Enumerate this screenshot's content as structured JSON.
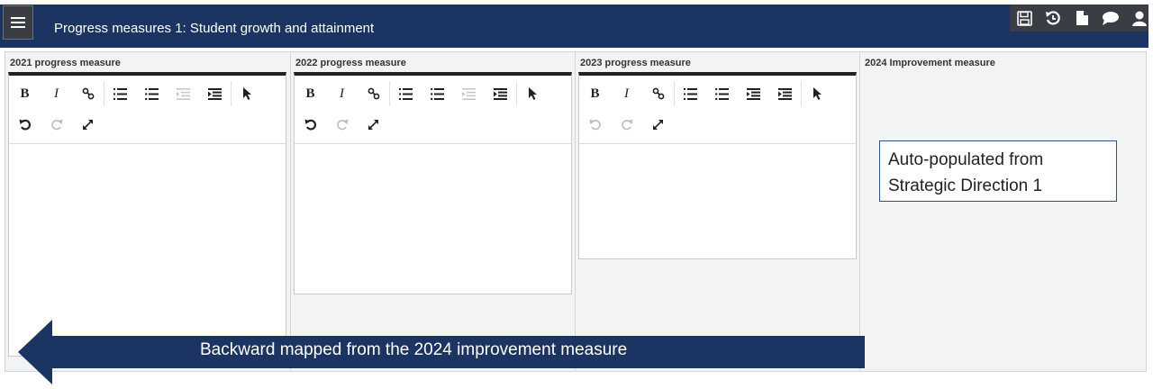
{
  "header": {
    "title": "Progress measures 1: Student growth and attainment",
    "menu_icon": "hamburger-icon",
    "tool_icons": [
      "save-icon",
      "history-icon",
      "document-icon",
      "comment-icon",
      "user-icon"
    ]
  },
  "columns": [
    {
      "label": "2021 progress measure"
    },
    {
      "label": "2022 progress measure"
    },
    {
      "label": "2023 progress measure"
    },
    {
      "label": "2024 Improvement measure"
    }
  ],
  "toolbar": {
    "bold": "B",
    "italic": "I",
    "icons": [
      "bold-icon",
      "italic-icon",
      "link-icon",
      "numbered-list-icon",
      "bullet-list-icon",
      "outdent-icon",
      "indent-icon",
      "pointer-icon",
      "undo-icon",
      "redo-icon",
      "expand-icon"
    ]
  },
  "callout": {
    "line1": "Auto-populated from",
    "line2": "Strategic Direction 1"
  },
  "arrow": {
    "label": "Backward mapped from the 2024 improvement measure"
  },
  "colors": {
    "header_bg": "#1c3461",
    "toolbar_group_bg": "#3a3d44",
    "arrow_fill": "#1c3461",
    "panel_bg": "#f2f3f5"
  }
}
